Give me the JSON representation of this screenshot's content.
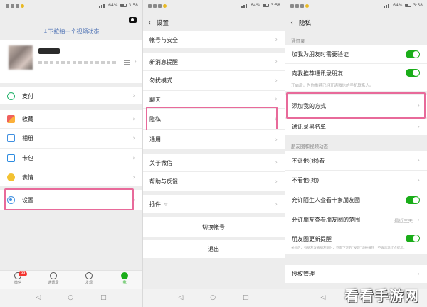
{
  "status": {
    "battery": "64%",
    "time": "3:58"
  },
  "me": {
    "pull_tip": "↓下拉拍一个视频动态",
    "menu": [
      {
        "label": "支付",
        "icon": "pay-icon"
      },
      {
        "label": "收藏",
        "icon": "favorites-icon"
      },
      {
        "label": "相册",
        "icon": "album-icon"
      },
      {
        "label": "卡包",
        "icon": "card-wallet-icon"
      },
      {
        "label": "表情",
        "icon": "sticker-icon"
      },
      {
        "label": "设置",
        "icon": "settings-icon"
      }
    ],
    "tabs": [
      {
        "label": "微信",
        "badge": "99"
      },
      {
        "label": "通讯录"
      },
      {
        "label": "发现"
      },
      {
        "label": "我"
      }
    ]
  },
  "settings": {
    "title": "设置",
    "items": [
      "帐号与安全",
      "新消息提醒",
      "勿扰模式",
      "聊天",
      "隐私",
      "通用",
      "关于微信",
      "帮助与反馈",
      "插件"
    ],
    "switch_account": "切换帐号",
    "logout": "退出"
  },
  "privacy": {
    "title": "隐私",
    "section_contacts": "通讯录",
    "verify_label": "加我为朋友时需要验证",
    "recommend_label": "向我推荐通讯录朋友",
    "recommend_note": "开启后，为你推荐已经开通微信的手机联系人。",
    "add_methods": "添加我的方式",
    "blacklist": "通讯录黑名单",
    "section_moments": "朋友圈和视频动态",
    "hide_from": "不让他(她)看",
    "dont_see": "不看他(她)",
    "strangers_ten": "允许陌生人查看十条朋友圈",
    "visible_range": "允许朋友查看朋友圈的范围",
    "visible_range_value": "最近三天",
    "moments_remind": "朋友圈更新提醒",
    "moments_remind_note": "关闭后，有朋友发表朋友圈时，界面下方的“发现”切换按钮上不再出现红点提示。",
    "auth": "授权管理"
  },
  "watermark": "看看手游网",
  "colors": {
    "accent": "#1aad19",
    "highlight": "#e86a9a",
    "link": "#4a6fb3"
  }
}
